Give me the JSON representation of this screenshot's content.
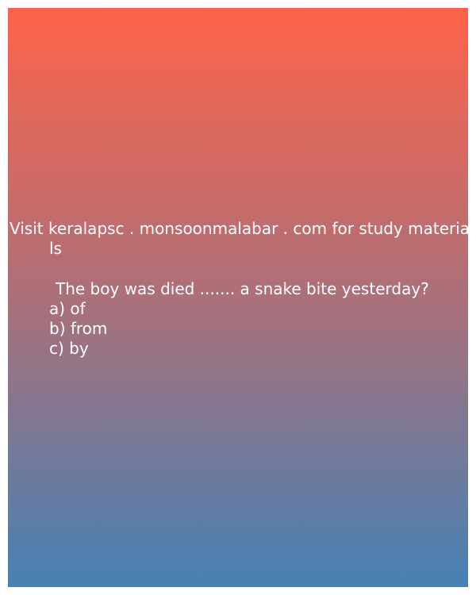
{
  "banner": {
    "visit_line1": "Visit keralapsc . monsoonmalabar . com for study materia",
    "visit_line2": "ls"
  },
  "question": {
    "text": "The boy was died ....... a snake bite yesterday?",
    "options": [
      "a) of",
      "b) from",
      "c) by"
    ]
  },
  "colors": {
    "gradient_top": "#ff634a",
    "gradient_middle": "#ab7079",
    "gradient_bottom": "#4681b4",
    "text": "#ffffff"
  }
}
